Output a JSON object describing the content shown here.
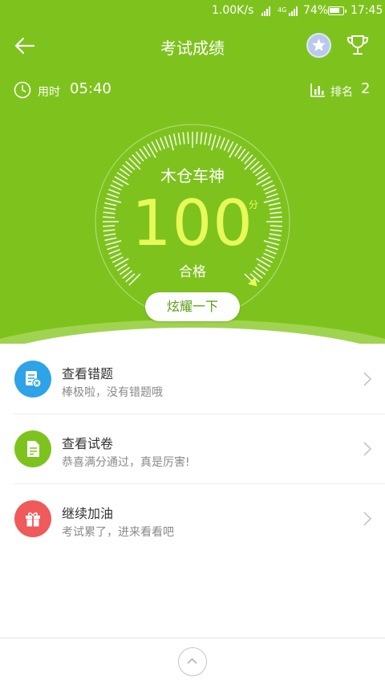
{
  "status_bar": {
    "net_speed": "1.00K/s",
    "network_type": "4G",
    "battery": "74%",
    "time": "17:45"
  },
  "header": {
    "title": "考试成绩"
  },
  "info": {
    "time_label": "用时",
    "time_value": "05:40",
    "rank_label": "排名",
    "rank_value": "2"
  },
  "result": {
    "nickname": "木仓车神",
    "score": "100",
    "unit": "分",
    "status": "合格",
    "score_fraction": 1.0
  },
  "share_button": {
    "label": "炫耀一下"
  },
  "list": [
    {
      "title": "查看错题",
      "subtitle": "棒极啦，没有错题哦",
      "icon": "wrong-questions-icon",
      "color": "#2ea3e8"
    },
    {
      "title": "查看试卷",
      "subtitle": "恭喜满分通过，真是厉害!",
      "icon": "paper-icon",
      "color": "#7ec31d"
    },
    {
      "title": "继续加油",
      "subtitle": "考试累了，进来看看吧",
      "icon": "gift-icon",
      "color": "#ef5a5a"
    }
  ],
  "colors": {
    "header_green": "#7ec31d",
    "score_yellow": "#e8f95a"
  }
}
